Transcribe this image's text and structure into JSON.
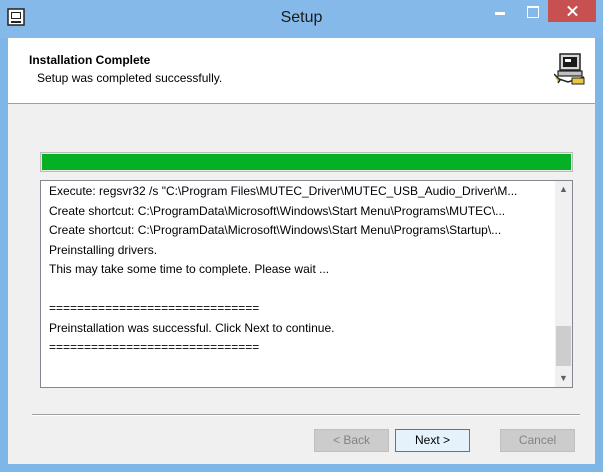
{
  "window": {
    "title": "Setup",
    "icon": "installer-app-icon"
  },
  "header": {
    "title": "Installation Complete",
    "subtitle": "Setup was completed successfully.",
    "icon": "computer-install-icon"
  },
  "progress": {
    "percent": 100,
    "color": "#06b025"
  },
  "log": {
    "lines": [
      "Execute: regsvr32 /s \"C:\\Program Files\\MUTEC_Driver\\MUTEC_USB_Audio_Driver\\M...",
      "Create shortcut: C:\\ProgramData\\Microsoft\\Windows\\Start Menu\\Programs\\MUTEC\\...",
      "Create shortcut: C:\\ProgramData\\Microsoft\\Windows\\Start Menu\\Programs\\Startup\\...",
      "Preinstalling drivers.",
      "This may take some time to complete. Please wait ...",
      "",
      "==============================",
      "Preinstallation was successful. Click Next to continue.",
      "=============================="
    ]
  },
  "buttons": {
    "back": "< Back",
    "next": "Next >",
    "cancel": "Cancel"
  },
  "colors": {
    "titlebar": "#84b9ea",
    "close": "#c75050"
  }
}
